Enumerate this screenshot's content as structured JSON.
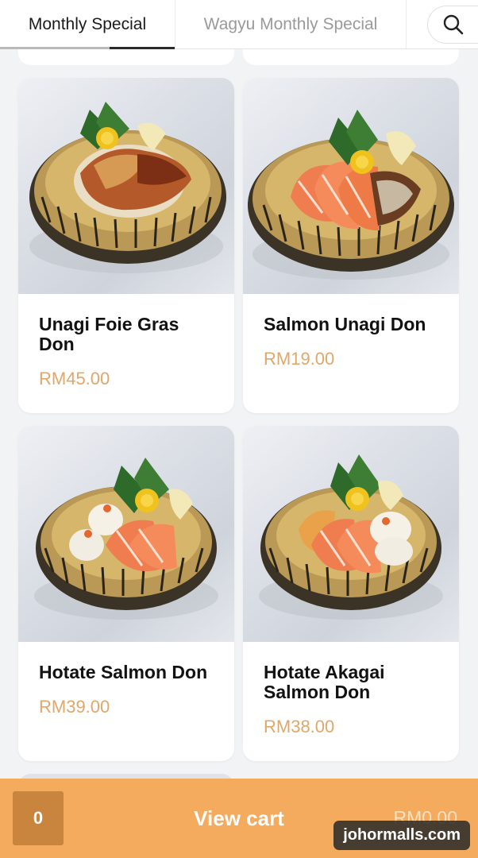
{
  "tabs": [
    {
      "label": "Monthly Special",
      "active": true
    },
    {
      "label": "Wagyu Monthly Special",
      "active": false
    }
  ],
  "search": {
    "icon": "search-icon"
  },
  "products": [
    {
      "name": "Unagi Foie Gras Don",
      "price": "RM45.00",
      "image": "unagi-foie-gras-don-bowl"
    },
    {
      "name": "Salmon Unagi Don",
      "price": "RM19.00",
      "image": "salmon-unagi-don-bowl"
    },
    {
      "name": "Hotate Salmon Don",
      "price": "RM39.00",
      "image": "hotate-salmon-don-bowl"
    },
    {
      "name": "Hotate Akagai Salmon Don",
      "price": "RM38.00",
      "image": "hotate-akagai-salmon-don-bowl"
    }
  ],
  "cart": {
    "count": "0",
    "label": "View cart",
    "total": "RM0.00"
  },
  "watermark": "johormalls.com",
  "colors": {
    "accent": "#f4ab5e",
    "price": "#e0a76b",
    "count_box": "#c9843e"
  }
}
